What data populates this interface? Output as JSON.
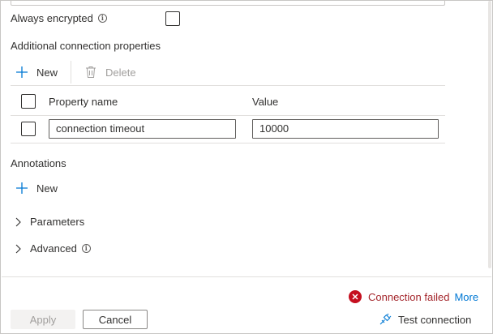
{
  "always_encrypted": {
    "label": "Always encrypted",
    "info_icon": "info-icon",
    "checked": false
  },
  "additional_properties": {
    "section_title": "Additional connection properties",
    "toolbar": {
      "new_label": "New",
      "delete_label": "Delete"
    },
    "columns": [
      "Property name",
      "Value"
    ],
    "rows": [
      {
        "property_name": "connection timeout",
        "value": "10000",
        "selected": false
      }
    ]
  },
  "annotations": {
    "section_title": "Annotations",
    "new_label": "New"
  },
  "expanders": {
    "parameters_label": "Parameters",
    "advanced_label": "Advanced"
  },
  "status": {
    "message": "Connection failed",
    "more_label": "More",
    "error_color": "#c50f1f",
    "link_color": "#0078d4"
  },
  "footer": {
    "apply_label": "Apply",
    "cancel_label": "Cancel",
    "test_connection_label": "Test connection"
  }
}
